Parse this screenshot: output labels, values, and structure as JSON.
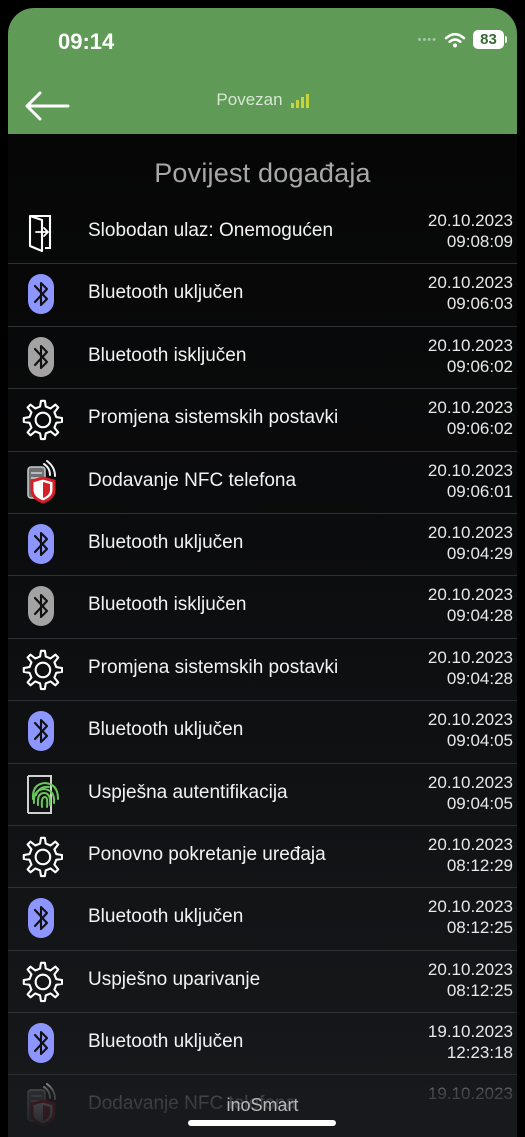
{
  "status_bar": {
    "time": "09:14",
    "battery": "83",
    "wifi_icon": "wifi-icon",
    "cellular_icon": "cellular-dots-icon"
  },
  "header": {
    "back_icon": "arrow-left-icon",
    "connection_status": "Povezan",
    "signal_icon": "signal-bars-icon"
  },
  "page": {
    "title": "Povijest događaja"
  },
  "events": [
    {
      "label": "Slobodan ulaz: Onemogućen",
      "date": "20.10.2023",
      "time": "09:08:09",
      "icon": "door-exit-icon"
    },
    {
      "label": "Bluetooth uključen",
      "date": "20.10.2023",
      "time": "09:06:03",
      "icon": "bluetooth-on-icon"
    },
    {
      "label": "Bluetooth isključen",
      "date": "20.10.2023",
      "time": "09:06:02",
      "icon": "bluetooth-off-icon"
    },
    {
      "label": "Promjena sistemskih postavki",
      "date": "20.10.2023",
      "time": "09:06:02",
      "icon": "gear-icon"
    },
    {
      "label": "Dodavanje NFC telefona",
      "date": "20.10.2023",
      "time": "09:06:01",
      "icon": "nfc-phone-icon"
    },
    {
      "label": "Bluetooth uključen",
      "date": "20.10.2023",
      "time": "09:04:29",
      "icon": "bluetooth-on-icon"
    },
    {
      "label": "Bluetooth isključen",
      "date": "20.10.2023",
      "time": "09:04:28",
      "icon": "bluetooth-off-icon"
    },
    {
      "label": "Promjena sistemskih postavki",
      "date": "20.10.2023",
      "time": "09:04:28",
      "icon": "gear-icon"
    },
    {
      "label": "Bluetooth uključen",
      "date": "20.10.2023",
      "time": "09:04:05",
      "icon": "bluetooth-on-icon"
    },
    {
      "label": "Uspješna autentifikacija",
      "date": "20.10.2023",
      "time": "09:04:05",
      "icon": "fingerprint-icon"
    },
    {
      "label": "Ponovno pokretanje uređaja",
      "date": "20.10.2023",
      "time": "08:12:29",
      "icon": "gear-icon"
    },
    {
      "label": "Bluetooth uključen",
      "date": "20.10.2023",
      "time": "08:12:25",
      "icon": "bluetooth-on-icon"
    },
    {
      "label": "Uspješno uparivanje",
      "date": "20.10.2023",
      "time": "08:12:25",
      "icon": "gear-icon"
    },
    {
      "label": "Bluetooth uključen",
      "date": "19.10.2023",
      "time": "12:23:18",
      "icon": "bluetooth-on-icon"
    },
    {
      "label": "Dodavanje NFC telefona",
      "date": "19.10.2023",
      "time": "",
      "icon": "nfc-phone-icon"
    }
  ],
  "footer": {
    "brand": "inoSmart"
  },
  "colors": {
    "header_green": "#5f9a57",
    "bluetooth_on": "#8d96ff",
    "bluetooth_off": "#a3a3a3",
    "signal_yellow": "#c5d53d",
    "nfc_red": "#d61f26",
    "fingerprint_green": "#69c75b"
  }
}
